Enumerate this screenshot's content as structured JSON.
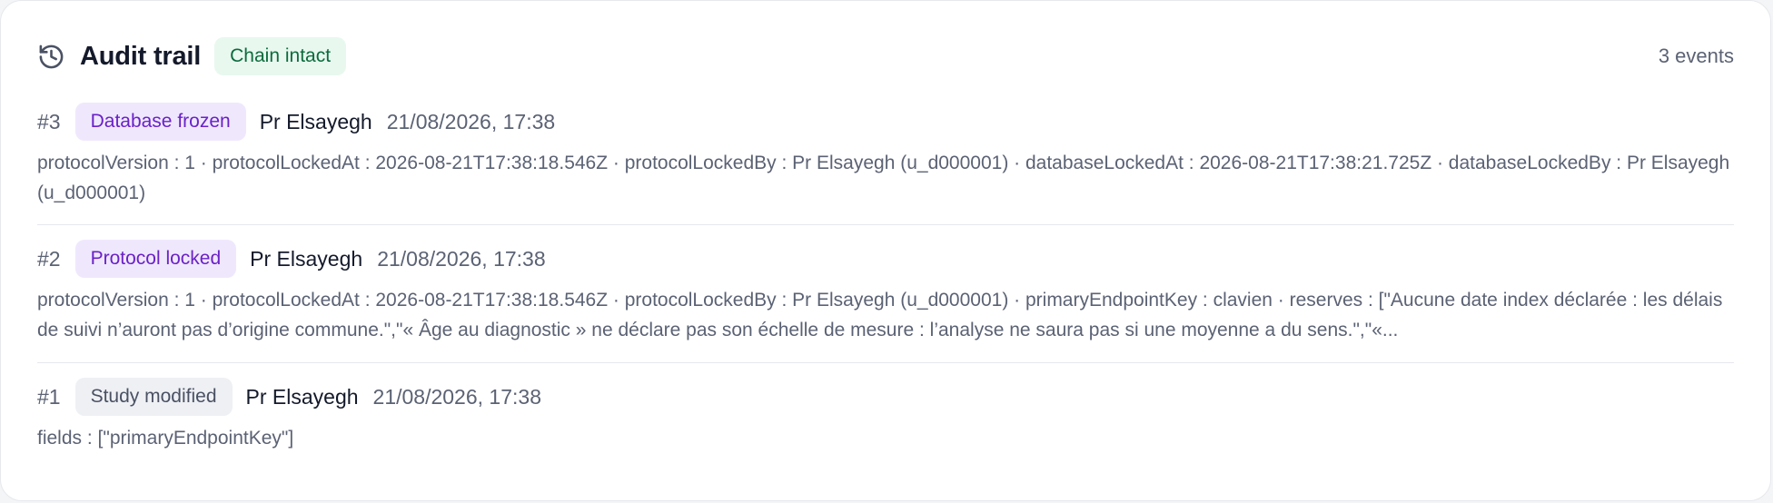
{
  "header": {
    "icon": "history-icon",
    "title": "Audit trail",
    "status_badge": "Chain intact",
    "event_count": "3 events"
  },
  "events": [
    {
      "number": "#3",
      "type": "Database frozen",
      "badge_color": "#6b21c8",
      "actor": "Pr Elsayegh",
      "timestamp": "21/08/2026, 17:38",
      "details": "protocolVersion : 1 · protocolLockedAt : 2026-08-21T17:38:18.546Z · protocolLockedBy : Pr Elsayegh (u_d000001) · databaseLockedAt : 2026-08-21T17:38:21.725Z · databaseLockedBy : Pr Elsayegh (u_d000001)"
    },
    {
      "number": "#2",
      "type": "Protocol locked",
      "badge_color": "#6b21c8",
      "actor": "Pr Elsayegh",
      "timestamp": "21/08/2026, 17:38",
      "details": "protocolVersion : 1 · protocolLockedAt : 2026-08-21T17:38:18.546Z · protocolLockedBy : Pr Elsayegh (u_d000001) · primaryEndpointKey : clavien · reserves : [\"Aucune date index déclarée : les délais de suivi n’auront pas d’origine commune.\",\"« Âge au diagnostic » ne déclare pas son échelle de mesure : l’analyse ne saura pas si une moyenne a du sens.\",\"«..."
    },
    {
      "number": "#1",
      "type": "Study modified",
      "badge_color": "#4a5163",
      "actor": "Pr Elsayegh",
      "timestamp": "21/08/2026, 17:38",
      "details": "fields : [\"primaryEndpointKey\"]"
    }
  ]
}
